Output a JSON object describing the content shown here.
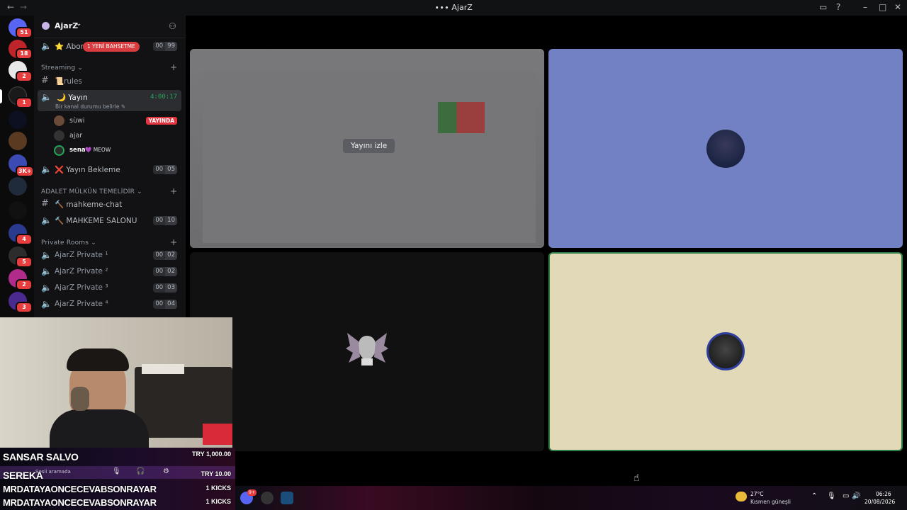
{
  "window": {
    "title": "AjarZ"
  },
  "server": {
    "name": "AjarZ",
    "chevron": "⌄",
    "add_member_icon": "person-add-icon"
  },
  "rail_badges": [
    "51",
    "18",
    "2",
    "1",
    "3K+",
    "4",
    "5",
    "2",
    "3"
  ],
  "channels": {
    "top_channel": {
      "label": "Abon",
      "mention_badge": "1 YENİ BAHSETME",
      "count": "00",
      "limit": "99"
    },
    "category_streaming": "Streaming",
    "rules": "📜rules",
    "yayin": {
      "label": "🌙 Yayın",
      "timer": "4:00:17",
      "status": "Bir kanal durumu belirle",
      "users": [
        {
          "name": "sùwi",
          "badge": "YAYINDA"
        },
        {
          "name": "ajar",
          "badge": ""
        },
        {
          "name": "sena",
          "badge": "💜 MEOW"
        }
      ]
    },
    "yayin_bekleme": {
      "label": "❌ Yayın Bekleme",
      "count": "00",
      "limit": "05"
    },
    "category_adalet": "ADALET MÜLKÜN TEMELİDİR",
    "mahkeme_chat": "🔨 mahkeme-chat",
    "mahkeme_salonu": {
      "label": "🔨 MAHKEME SALONU",
      "count": "00",
      "limit": "10"
    },
    "category_private": "Private Rooms",
    "private": [
      {
        "label": "AjarZ Private ¹",
        "count": "00",
        "limit": "02"
      },
      {
        "label": "AjarZ Private ²",
        "count": "00",
        "limit": "02"
      },
      {
        "label": "AjarZ Private ³",
        "count": "00",
        "limit": "03"
      },
      {
        "label": "AjarZ Private ⁴",
        "count": "00",
        "limit": "04"
      }
    ]
  },
  "stage": {
    "watch_stream_label": "Yayını izle",
    "tile_colors": {
      "top_right": "#7181c3",
      "bottom_left": "#111111",
      "bottom_right": "#e2d9b8",
      "speaking_border": "#2d7d46"
    }
  },
  "overlay": {
    "voice_status": "Sesli aramada",
    "donations": [
      {
        "name": "SANSAR SALVO",
        "amount": "TRY 1,000.00"
      },
      {
        "name": "SEREKA",
        "amount": "TRY 10.00"
      },
      {
        "name": "MRDATAYAONCECEVABSONRAYAR",
        "amount": "1 KICKS"
      },
      {
        "name": "MRDATAYAONCECEVABSONRAYAR",
        "amount": "1 KICKS"
      }
    ]
  },
  "taskbar": {
    "discord_badge": "9+",
    "weather_temp": "27°C",
    "weather_desc": "Kısmen güneşli",
    "time": "06:26",
    "date": "20/08/2026"
  }
}
